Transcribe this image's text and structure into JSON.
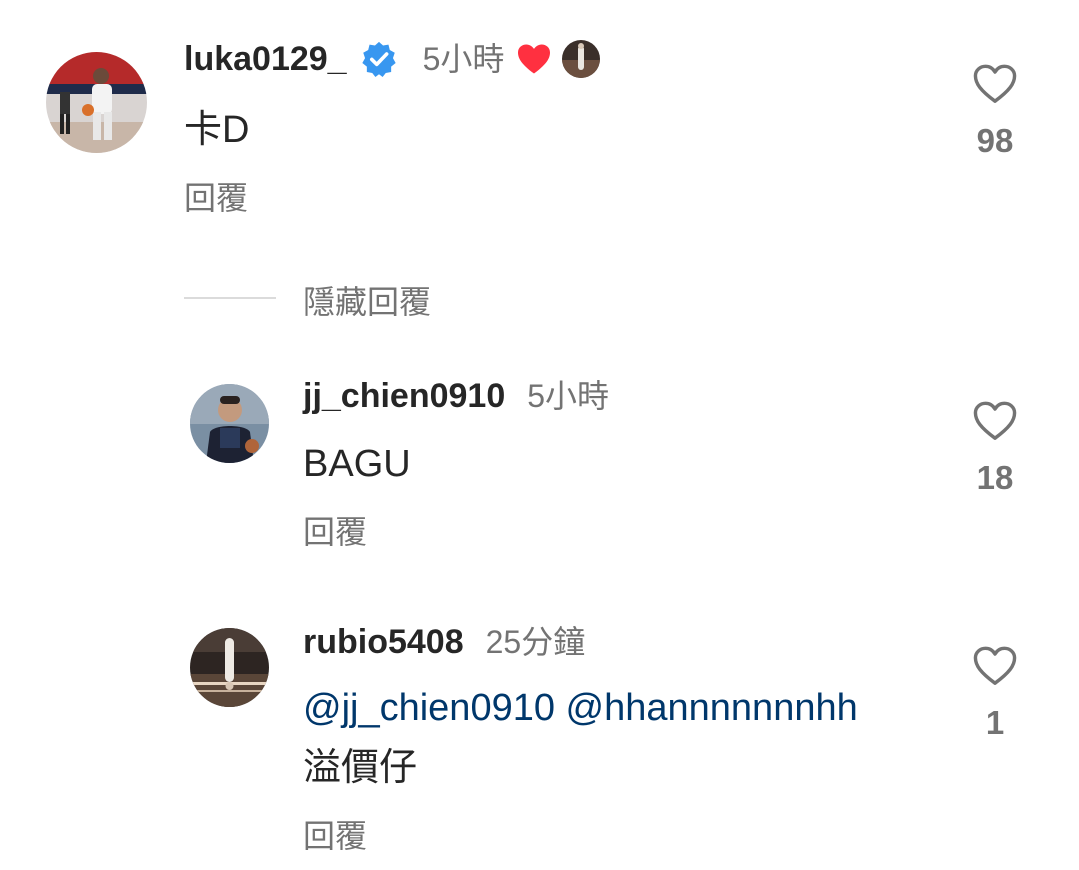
{
  "comments": [
    {
      "username": "luka0129_",
      "verified": true,
      "time": "5小時",
      "liked_by_author": true,
      "text": "卡D",
      "reply_label": "回覆",
      "like_count": "98",
      "avatar_icon": "basketball-player-avatar"
    }
  ],
  "thread": {
    "hide_replies_label": "隱藏回覆",
    "replies": [
      {
        "username": "jj_chien0910",
        "time": "5小時",
        "text": "BAGU",
        "reply_label": "回覆",
        "like_count": "18",
        "avatar_icon": "person-portrait-avatar"
      },
      {
        "username": "rubio5408",
        "time": "25分鐘",
        "mentions": [
          "@jj_chien0910",
          "@hhannnnnnnhh"
        ],
        "text": "溢價仔",
        "reply_label": "回覆",
        "like_count": "1",
        "avatar_icon": "arena-avatar"
      }
    ]
  },
  "colors": {
    "verified_badge": "#3897f0",
    "heart_red": "#ff3040",
    "mention": "#00376b",
    "secondary_text": "#737373"
  }
}
